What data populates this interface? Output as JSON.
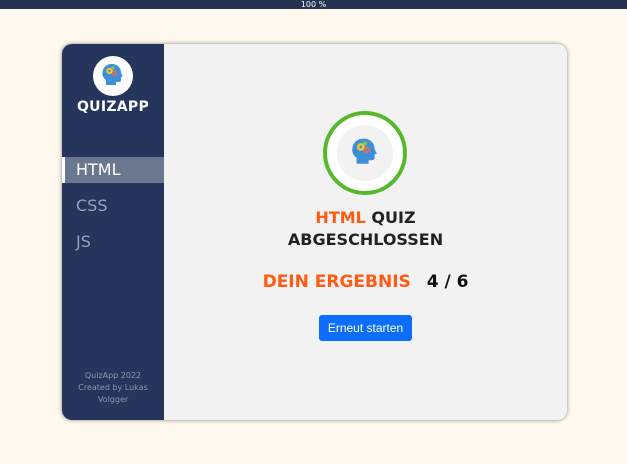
{
  "zoom": "100 %",
  "app": {
    "title": "QUIZAPP",
    "logo_icon": "brain-gears-head-icon"
  },
  "sidebar": {
    "items": [
      {
        "label": "HTML",
        "active": true
      },
      {
        "label": "CSS",
        "active": false
      },
      {
        "label": "JS",
        "active": false
      }
    ],
    "footer": [
      "QuizApp 2022",
      "Created by Lukas",
      "Volgger"
    ]
  },
  "result": {
    "icon": "brain-gears-head-icon",
    "ring_color": "#58b82d",
    "quiz_name": "HTML",
    "heading_rest": "QUIZ",
    "heading_line2": "ABGESCHLOSSEN",
    "score_label": "DEIN ERGEBNIS",
    "score_value": "4 / 6",
    "restart_label": "Erneut starten"
  },
  "colors": {
    "sidebar": "#25355b",
    "accent": "#ff5b14",
    "button": "#0d6efd",
    "page_background": "#fdf9ef"
  }
}
